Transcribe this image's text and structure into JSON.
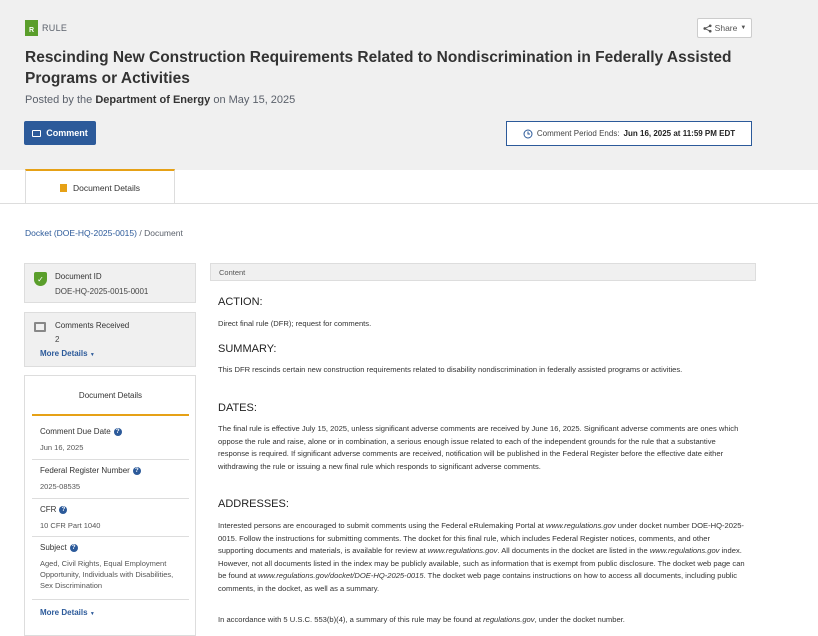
{
  "header": {
    "doc_type_icon": "R",
    "doc_type": "RULE",
    "share_label": "Share",
    "title": "Rescinding New Construction Requirements Related to Nondiscrimination in Federally Assisted Programs or Activities",
    "posted_prefix": "Posted by the",
    "agency": "Department of Energy",
    "posted_suffix": "on May 15, 2025",
    "comment_label": "Comment",
    "period_label": "Comment Period Ends:",
    "period_value": "Jun 16, 2025 at 11:59 PM EDT"
  },
  "tabs": [
    {
      "label": "Document Details"
    }
  ],
  "breadcrumb": {
    "docket": "Docket (DOE-HQ-2025-0015)",
    "separator": "/",
    "current": "Document"
  },
  "sidebar": {
    "doc_id_label": "Document ID",
    "doc_id_value": "DOE-HQ-2025-0015-0001",
    "comments_label": "Comments Received",
    "comments_value": "2",
    "more_details": "More Details",
    "details_title": "Document Details",
    "fields": [
      {
        "label": "Comment Due Date",
        "value": "Jun 16, 2025"
      },
      {
        "label": "Federal Register Number",
        "value": "2025-08535"
      },
      {
        "label": "CFR",
        "value": "10 CFR Part 1040"
      },
      {
        "label": "Subject",
        "value": "Aged, Civil Rights, Equal Employment Opportunity, Individuals with Disabilities, Sex Discrimination"
      }
    ],
    "more_details_2": "More Details"
  },
  "content": {
    "header": "Content",
    "action_head": "ACTION:",
    "action_text": "Direct final rule (DFR); request for comments.",
    "summary_head": "SUMMARY:",
    "summary_text": "This DFR rescinds certain new construction requirements related to disability nondiscrimination in federally assisted programs or activities.",
    "dates_head": "DATES:",
    "dates_text": "The final rule is effective July 15, 2025, unless significant adverse comments are received by June 16, 2025. Significant adverse comments are ones which oppose the rule and raise, alone or in combination, a serious enough issue related to each of the independent grounds for the rule that a substantive response is required. If significant adverse comments are received, notification will be published in the Federal Register before the effective date either withdrawing the rule or issuing a new final rule which responds to significant adverse comments.",
    "addresses_head": "ADDRESSES:",
    "addr_1": "Interested persons are encouraged to submit comments using the Federal eRulemaking Portal at ",
    "addr_site1": "www.regulations.gov",
    "addr_2": " under docket number DOE-HQ-2025-0015. Follow the instructions for submitting comments. The docket for this final rule, which includes Federal Register notices, comments, and other supporting documents and materials, is available for review at ",
    "addr_site2": "www.regulations.gov",
    "addr_3": ". All documents in the docket are listed in the ",
    "addr_site3": "www.regulations.gov",
    "addr_4": " index. However, not all documents listed in the index may be publicly available, such as information that is exempt from public disclosure. The docket web page can be found at ",
    "addr_site4": "www.regulations.gov/docket/DOE-HQ-2025-0015",
    "addr_5": ". The docket web page contains instructions on how to access all documents, including public comments, in the docket, as well as a summary.",
    "usc_1": "In accordance with 5 U.S.C. 553(b)(4), a summary of this rule may be found at ",
    "usc_site": "regulations.gov",
    "usc_2": ", under the docket number."
  }
}
